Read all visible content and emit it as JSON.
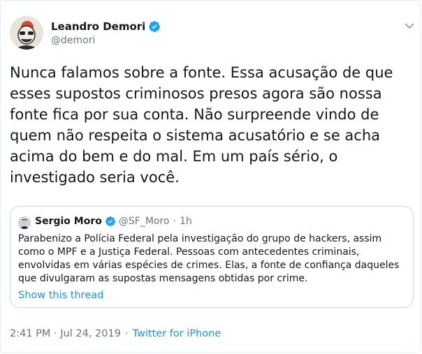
{
  "author": {
    "name": "Leandro Demori",
    "handle": "@demori"
  },
  "tweet": {
    "text": "Nunca falamos sobre a fonte. Essa acusação de que esses supostos criminosos presos agora são nossa fonte fica por sua conta. Não surpreende vindo de quem não respeita o sistema acusatório e se acha acima do bem e do mal. Em um país sério, o investigado seria você."
  },
  "quoted": {
    "name": "Sergio Moro",
    "handle": "@SF_Moro",
    "dot": "·",
    "time": "1h",
    "text": "Parabenizo a Polícia Federal pela investigação do grupo de hackers, assim como o MPF e a Justiça Federal. Pessoas com antecedentes criminais, envolvidas em várias espécies de crimes. Elas, a fonte de confiança daqueles que divulgaram as supostas mensagens obtidas por crime.",
    "thread_link": "Show this thread"
  },
  "meta": {
    "timestamp": "2:41 PM · Jul 24, 2019",
    "separator": "·",
    "source": "Twitter for iPhone"
  },
  "colors": {
    "link": "#1b95e0",
    "verified": "#1da1f2",
    "muted": "#657786"
  }
}
